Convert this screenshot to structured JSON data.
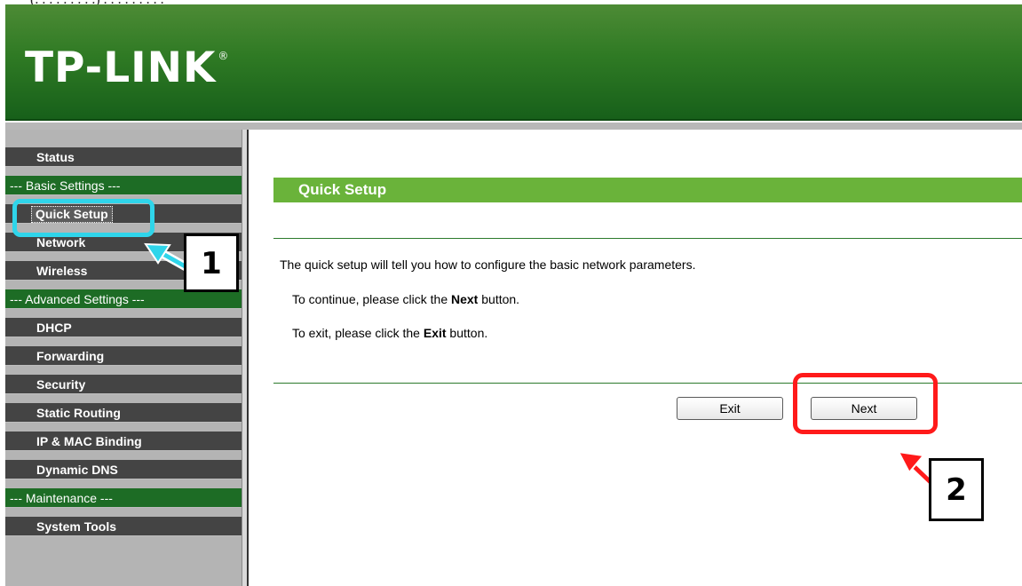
{
  "top_fragment": "(.  . . . . . . . .)  .  .  .  .  .  .  .  .  .",
  "brand": {
    "name": "TP-LINK",
    "mark": "®"
  },
  "sidebar": {
    "items": [
      {
        "label": "Status",
        "type": "item"
      },
      {
        "label": "--- Basic Settings ---",
        "type": "section"
      },
      {
        "label": "Quick Setup",
        "type": "item",
        "active": true
      },
      {
        "label": "Network",
        "type": "item"
      },
      {
        "label": "Wireless",
        "type": "item"
      },
      {
        "label": "--- Advanced Settings ---",
        "type": "section"
      },
      {
        "label": "DHCP",
        "type": "item"
      },
      {
        "label": "Forwarding",
        "type": "item"
      },
      {
        "label": "Security",
        "type": "item"
      },
      {
        "label": "Static Routing",
        "type": "item"
      },
      {
        "label": "IP & MAC Binding",
        "type": "item"
      },
      {
        "label": "Dynamic DNS",
        "type": "item"
      },
      {
        "label": "--- Maintenance ---",
        "type": "section"
      },
      {
        "label": "System Tools",
        "type": "item"
      }
    ]
  },
  "main": {
    "title": "Quick Setup",
    "line1": "The quick setup will tell you how to configure the basic network parameters.",
    "line2_pre": "To continue, please click the ",
    "line2_bold": "Next",
    "line2_post": " button.",
    "line3_pre": "To exit, please click the ",
    "line3_bold": "Exit",
    "line3_post": "  button.",
    "exit_label": "Exit",
    "next_label": "Next"
  },
  "annotations": {
    "step1": "1",
    "step2": "2"
  },
  "colors": {
    "header": "#2f7a24",
    "section": "#1d6c25",
    "nav": "#444444",
    "title_bar": "#6ab33a",
    "highlight_1": "#2fd5ea",
    "highlight_2": "#ff1a1a"
  }
}
